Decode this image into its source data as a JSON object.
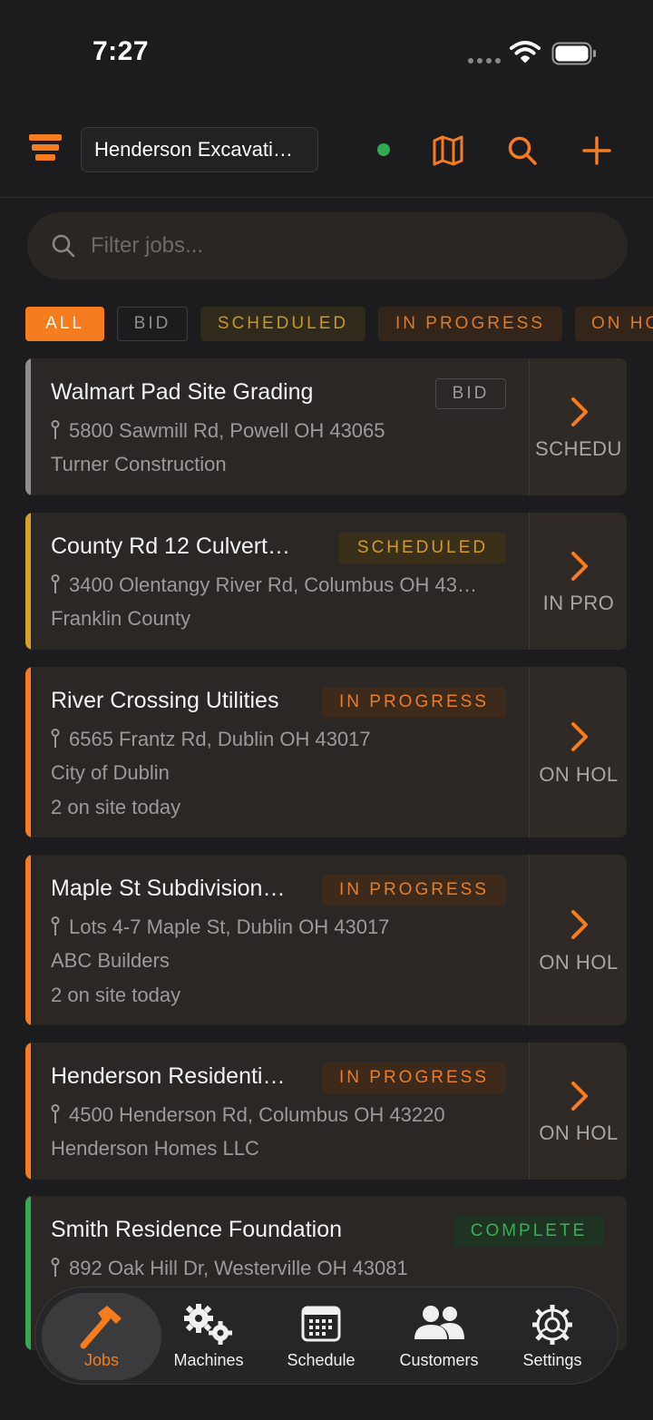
{
  "status_bar": {
    "time": "7:27"
  },
  "header": {
    "company": "Henderson Excavati…",
    "icons": {
      "logo": "layers-icon",
      "map": "map-icon",
      "search": "search-icon",
      "add": "plus-icon"
    }
  },
  "search": {
    "placeholder": "Filter jobs..."
  },
  "filters": [
    "ALL",
    "BID",
    "SCHEDULED",
    "IN PROGRESS",
    "ON HO"
  ],
  "jobs": [
    {
      "title": "Walmart Pad Site Grading",
      "status": "BID",
      "address": "5800 Sawmill Rd, Powell OH 43065",
      "customer": "Turner Construction",
      "onsite": "",
      "next": "SCHEDU",
      "accent": "#8e8e8e"
    },
    {
      "title": "County Rd 12 Culvert…",
      "status": "SCHEDULED",
      "address": "3400 Olentangy River Rd, Columbus OH 43…",
      "customer": "Franklin County",
      "onsite": "",
      "next": "IN PRO",
      "accent": "#d4a12a"
    },
    {
      "title": "River Crossing Utilities",
      "status": "IN PROGRESS",
      "address": "6565 Frantz Rd, Dublin OH 43017",
      "customer": "City of Dublin",
      "onsite": "2 on site today",
      "next": "ON HOL",
      "accent": "#f57c1f"
    },
    {
      "title": "Maple St Subdivision…",
      "status": "IN PROGRESS",
      "address": "Lots 4-7 Maple St, Dublin OH 43017",
      "customer": "ABC Builders",
      "onsite": "2 on site today",
      "next": "ON HOL",
      "accent": "#f57c1f"
    },
    {
      "title": "Henderson Residenti…",
      "status": "IN PROGRESS",
      "address": "4500 Henderson Rd, Columbus OH 43220",
      "customer": "Henderson Homes LLC",
      "onsite": "",
      "next": "ON HOL",
      "accent": "#f57c1f"
    },
    {
      "title": "Smith Residence Foundation",
      "status": "COMPLETE",
      "address": "892 Oak Hill Dr, Westerville OH 43081",
      "customer": "",
      "onsite": "",
      "next": "",
      "accent": "#34a853"
    }
  ],
  "tabs": [
    {
      "label": "Jobs",
      "icon": "hammer-icon"
    },
    {
      "label": "Machines",
      "icon": "gears-icon"
    },
    {
      "label": "Schedule",
      "icon": "calendar-icon"
    },
    {
      "label": "Customers",
      "icon": "users-icon"
    },
    {
      "label": "Settings",
      "icon": "settings-icon"
    }
  ],
  "colors": {
    "accent": "#f57c1f",
    "background": "#1c1c1e",
    "card": "#2a2725"
  }
}
